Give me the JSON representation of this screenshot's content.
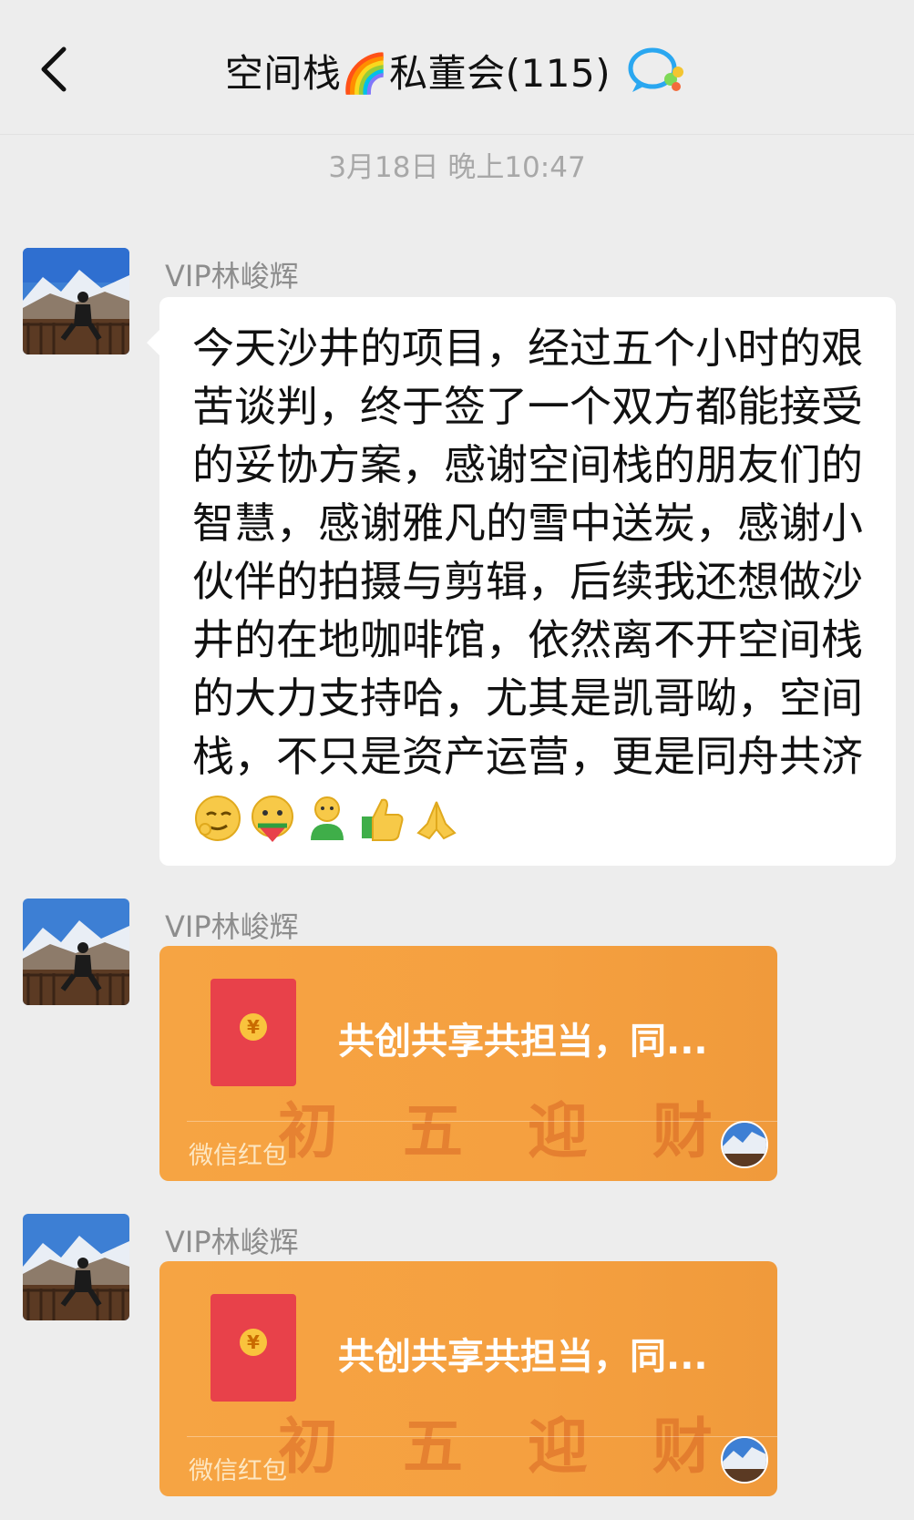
{
  "header": {
    "title": "空间栈🌈私董会(115)"
  },
  "timestamp": "3月18日 晚上10:47",
  "messages": [
    {
      "sender": "VIP林峻辉",
      "text": "今天沙井的项目，经过五个小时的艰苦谈判，终于签了一个双方都能接受的妥协方案，感谢空间栈的朋友们的智慧，感谢雅凡的雪中送炭，感谢小伙伴的拍摄与剪辑，后续我还想做沙井的在地咖啡馆，依然离不开空间栈的大力支持哈，尤其是凯哥呦，空间栈，不只是资产运营，更是同舟共济"
    },
    {
      "sender": "VIP林峻辉",
      "redpacket_title": "共创共享共担当，同...",
      "redpacket_label": "微信红包",
      "redpacket_bg": "初 五 迎 财 神"
    },
    {
      "sender": "VIP林峻辉",
      "redpacket_title": "共创共享共担当，同...",
      "redpacket_label": "微信红包",
      "redpacket_bg": "初 五 迎 财 神"
    }
  ],
  "colors": {
    "background": "#ededed",
    "bubble": "#ffffff",
    "redpacket": "#f6a443",
    "envelope": "#e8414a"
  }
}
